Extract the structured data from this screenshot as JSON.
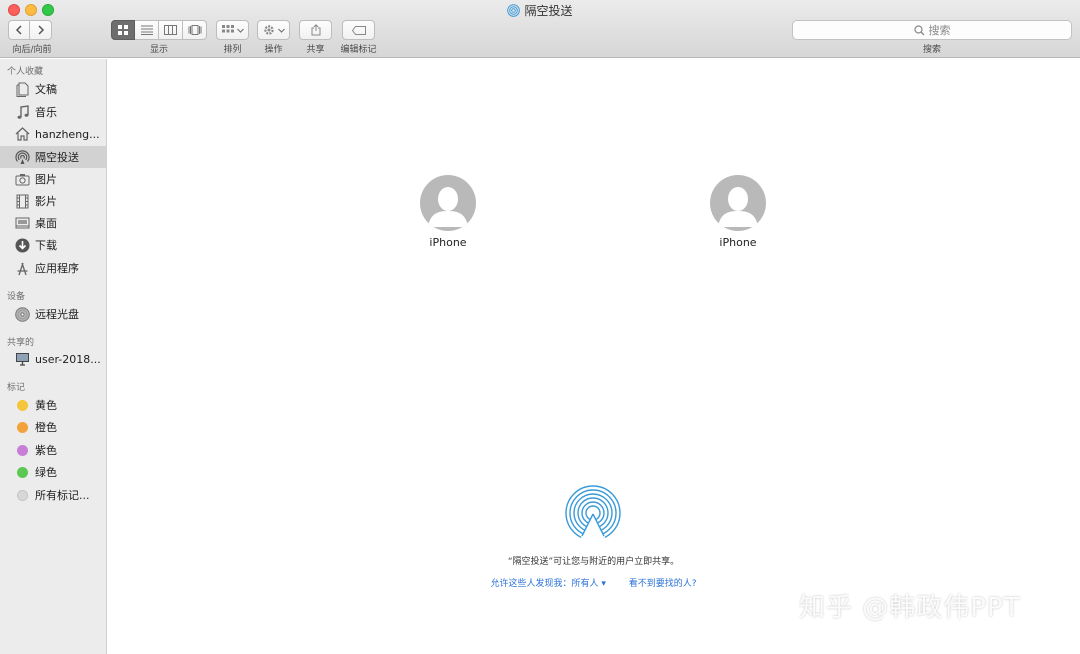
{
  "window": {
    "title": "隔空投送"
  },
  "toolbar": {
    "nav_label": "向后/向前",
    "view_label": "显示",
    "sort_label": "排列",
    "action_label": "操作",
    "share_label": "共享",
    "tags_label": "编辑标记",
    "search_placeholder": "搜索",
    "search_label": "搜索"
  },
  "sidebar": {
    "favorites_header": "个人收藏",
    "favorites": [
      {
        "label": "文稿",
        "icon": "document-icon"
      },
      {
        "label": "音乐",
        "icon": "music-icon"
      },
      {
        "label": "hanzheng...",
        "icon": "home-icon"
      },
      {
        "label": "隔空投送",
        "icon": "airdrop-icon",
        "selected": true
      },
      {
        "label": "图片",
        "icon": "camera-icon"
      },
      {
        "label": "影片",
        "icon": "film-icon"
      },
      {
        "label": "桌面",
        "icon": "desktop-icon"
      },
      {
        "label": "下载",
        "icon": "download-icon"
      },
      {
        "label": "应用程序",
        "icon": "applications-icon"
      }
    ],
    "devices_header": "设备",
    "devices": [
      {
        "label": "远程光盘",
        "icon": "disc-icon"
      }
    ],
    "shared_header": "共享的",
    "shared": [
      {
        "label": "user-2018...",
        "icon": "computer-icon"
      }
    ],
    "tags_header": "标记",
    "tags": [
      {
        "label": "黄色",
        "color": "#f5c63b"
      },
      {
        "label": "橙色",
        "color": "#f3a23b"
      },
      {
        "label": "紫色",
        "color": "#c77fd6"
      },
      {
        "label": "绿色",
        "color": "#5cc853"
      },
      {
        "label": "所有标记...",
        "color": "#d8d8d8"
      }
    ]
  },
  "main": {
    "devices": [
      {
        "name": "iPhone"
      },
      {
        "name": "iPhone"
      }
    ],
    "info_text": "“隔空投送”可让您与附近的用户立即共享。",
    "discover_link": "允许这些人发现我：所有人 ▾",
    "help_link": "看不到要找的人?"
  },
  "watermark": "知乎 @韩政伟PPT",
  "colors": {
    "accent": "#2a72d8",
    "airdrop": "#3a9ad9",
    "selection": "#d2d2d2"
  }
}
